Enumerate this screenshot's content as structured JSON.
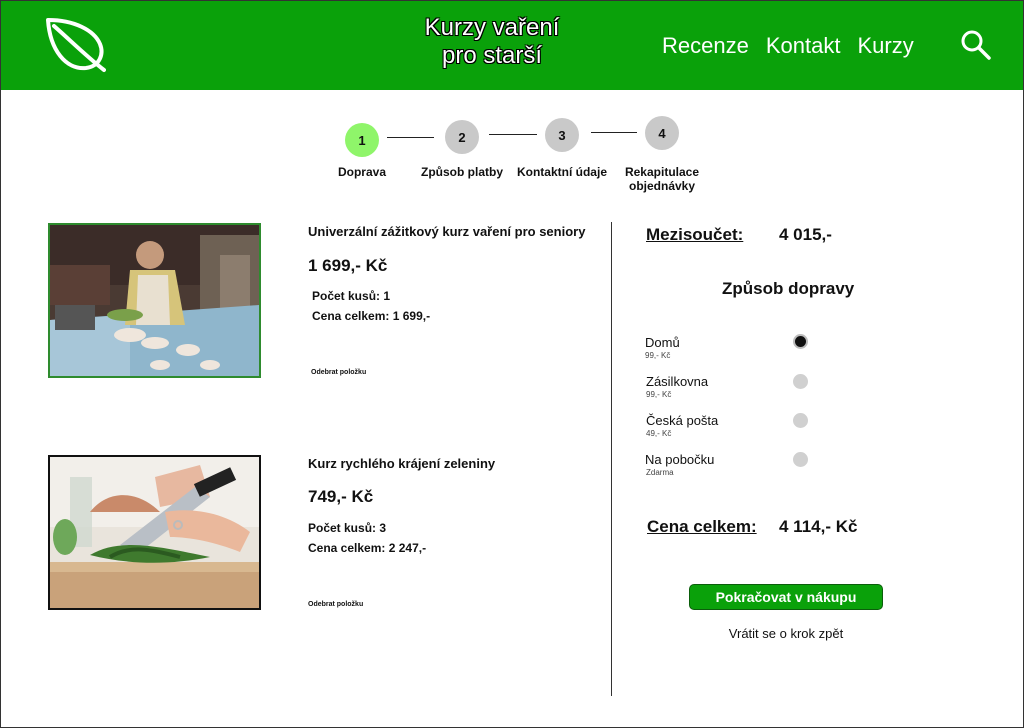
{
  "header": {
    "title_line1": "Kurzy vaření",
    "title_line2": "pro starší",
    "nav": [
      "Recenze",
      "Kontakt",
      "Kurzy"
    ],
    "brand_color": "#0aa10a"
  },
  "stepper": {
    "steps": [
      {
        "number": "1",
        "label": "Doprava",
        "active": true
      },
      {
        "number": "2",
        "label": "Způsob platby",
        "active": false
      },
      {
        "number": "3",
        "label": "Kontaktní údaje",
        "active": false
      },
      {
        "number": "4",
        "label_line1": "Rekapitulace",
        "label_line2": "objednávky",
        "active": false
      }
    ]
  },
  "cart": {
    "items": [
      {
        "name": "Univerzální zážitkový kurz vaření pro seniory",
        "price": "1 699,- Kč",
        "quantity_text": "Počet kusů: 1",
        "total_text": "Cena celkem: 1 699,-",
        "remove_label": "Odebrat položku",
        "image": "woman-baking-photo"
      },
      {
        "name": "Kurz rychlého krájení zeleniny",
        "price": "749,- Kč",
        "quantity_text": "Počet kusů: 3",
        "total_text": "Cena celkem: 2 247,-",
        "remove_label": "Odebrat položku",
        "image": "chopping-herbs-photo"
      }
    ]
  },
  "summary": {
    "subtotal_label": "Mezisoučet:",
    "subtotal_value": "4 015,-",
    "shipping_title": "Způsob dopravy",
    "shipping_options": [
      {
        "name": "Domů",
        "price": "99,- Kč",
        "selected": true
      },
      {
        "name": "Zásilkovna",
        "price": "99,- Kč",
        "selected": false
      },
      {
        "name": "Česká pošta",
        "price": "49,- Kč",
        "selected": false
      },
      {
        "name": "Na pobočku",
        "price": "Zdarma",
        "selected": false
      }
    ],
    "total_label": "Cena celkem:",
    "total_value": "4 114,- Kč",
    "continue_label": "Pokračovat v nákupu",
    "back_label": "Vrátit se o krok zpět"
  }
}
